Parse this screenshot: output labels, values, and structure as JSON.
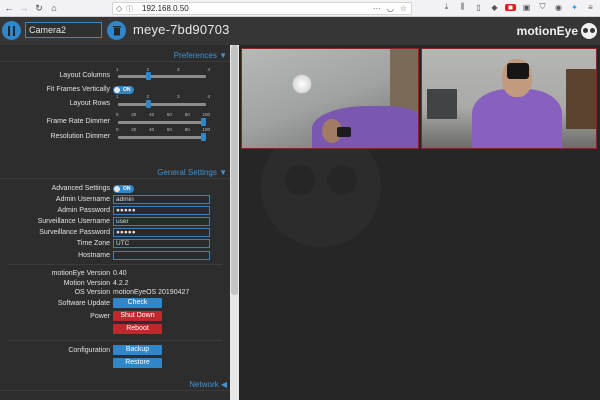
{
  "browser": {
    "url": "192.168.0.50",
    "back_icon": "arrow-left-icon",
    "forward_icon": "arrow-right-icon",
    "reload_icon": "reload-icon",
    "home_icon": "home-icon"
  },
  "header": {
    "camera_select_value": "Camera2",
    "host_title": "meye-7bd90703",
    "brand": "motionEye"
  },
  "preferences": {
    "section_title": "Preferences",
    "layout_columns": {
      "label": "Layout Columns",
      "ticks": [
        "1",
        "2",
        "3",
        "4"
      ],
      "value": 2,
      "min": 1,
      "max": 4
    },
    "fit_frames": {
      "label": "Fit Frames Vertically",
      "state": "ON"
    },
    "layout_rows": {
      "label": "Layout Rows",
      "ticks": [
        "1",
        "2",
        "3",
        "4"
      ],
      "value": 2,
      "min": 1,
      "max": 4
    },
    "frame_rate_dimmer": {
      "label": "Frame Rate Dimmer",
      "ticks": [
        "0",
        "20",
        "40",
        "60",
        "80",
        "100"
      ],
      "value": 100,
      "min": 0,
      "max": 100
    },
    "resolution_dimmer": {
      "label": "Resolution Dimmer",
      "ticks": [
        "0",
        "20",
        "40",
        "60",
        "80",
        "100"
      ],
      "value": 100,
      "min": 0,
      "max": 100
    }
  },
  "general": {
    "section_title": "General Settings",
    "advanced_settings": {
      "label": "Advanced Settings",
      "state": "ON"
    },
    "admin_username": {
      "label": "Admin Username",
      "value": "admin"
    },
    "admin_password": {
      "label": "Admin Password",
      "value": "●●●●●"
    },
    "surveillance_username": {
      "label": "Surveillance Username",
      "value": "user"
    },
    "surveillance_password": {
      "label": "Surveillance Password",
      "value": "●●●●●"
    },
    "time_zone": {
      "label": "Time Zone",
      "value": "UTC"
    },
    "hostname": {
      "label": "Hostname",
      "value": ""
    },
    "motioneye_version": {
      "label": "motionEye Version",
      "value": "0.40"
    },
    "motion_version": {
      "label": "Motion Version",
      "value": "4.2.2"
    },
    "os_version": {
      "label": "OS Version",
      "value": "motionEyeOS 20190427"
    },
    "software_update": {
      "label": "Software Update",
      "button": "Check"
    },
    "power": {
      "label": "Power",
      "shutdown": "Shut Down",
      "reboot": "Reboot"
    },
    "configuration": {
      "label": "Configuration",
      "backup": "Backup",
      "restore": "Restore"
    }
  },
  "network": {
    "section_title": "Network"
  },
  "colors": {
    "accent": "#2f86c8",
    "danger": "#c1272d",
    "frame_border": "#8b2424"
  }
}
